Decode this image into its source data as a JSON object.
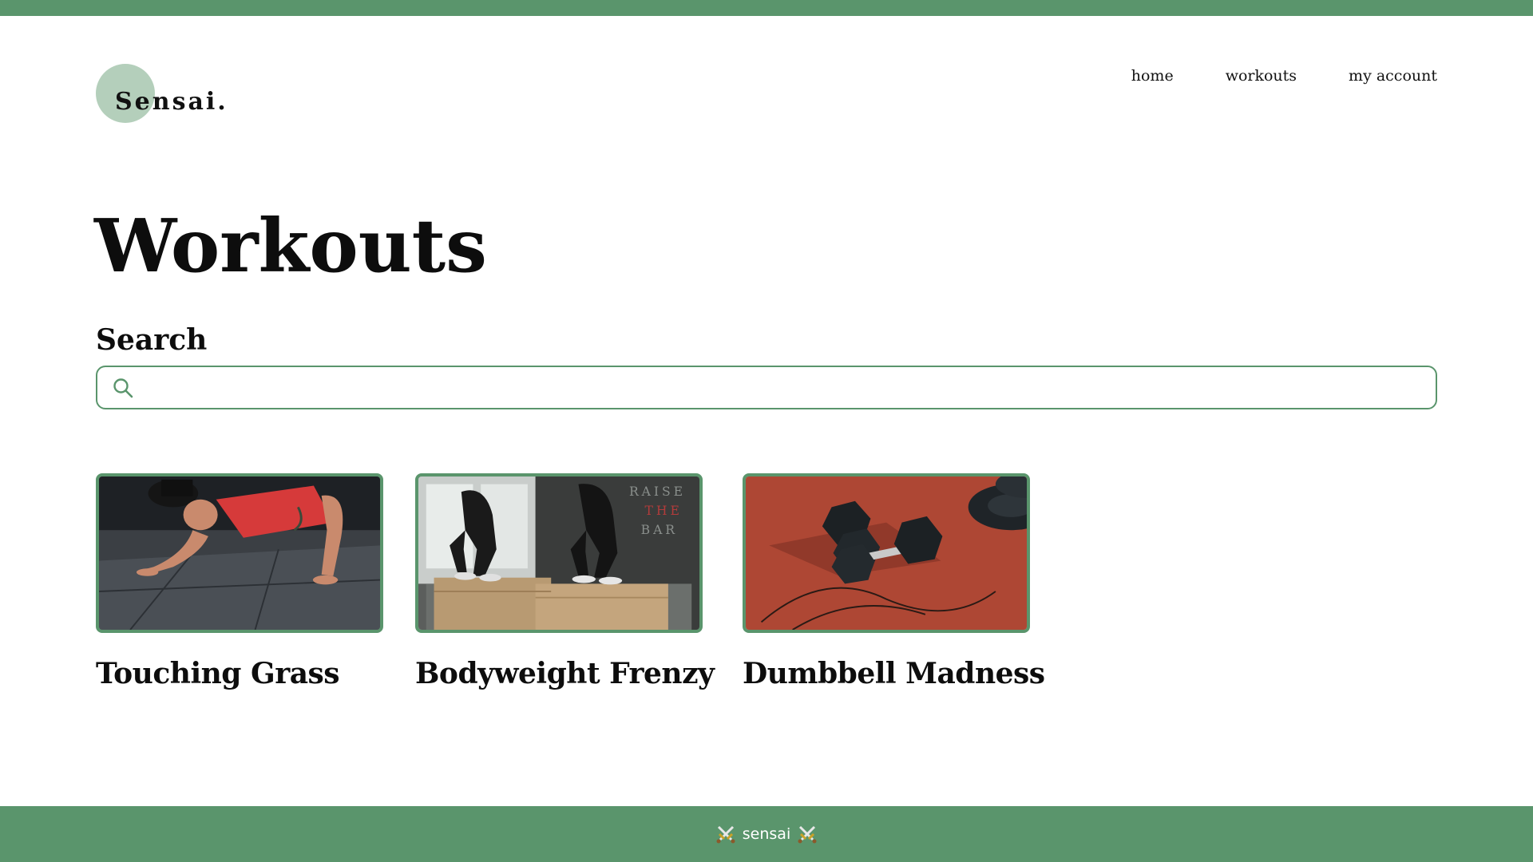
{
  "header": {
    "logo_text": "Sensai.",
    "nav": [
      {
        "label": "home"
      },
      {
        "label": "workouts"
      },
      {
        "label": "my account"
      }
    ]
  },
  "main": {
    "title": "Workouts",
    "search": {
      "label": "Search",
      "icon": "search-icon",
      "value": "",
      "placeholder": ""
    },
    "workouts": [
      {
        "title": "Touching Grass",
        "image": "man doing push-up on gym floor"
      },
      {
        "title": "Bodyweight Frenzy",
        "image": "two people doing box jumps in gym"
      },
      {
        "title": "Dumbbell Madness",
        "image": "hex dumbbells on red running track"
      }
    ]
  },
  "footer": {
    "text": "sensai",
    "icon": "crossed-swords-icon"
  },
  "colors": {
    "accent": "#5a956c",
    "logo_circle": "#b4cfbb",
    "text": "#0d0d0d",
    "background": "#ffffff"
  }
}
